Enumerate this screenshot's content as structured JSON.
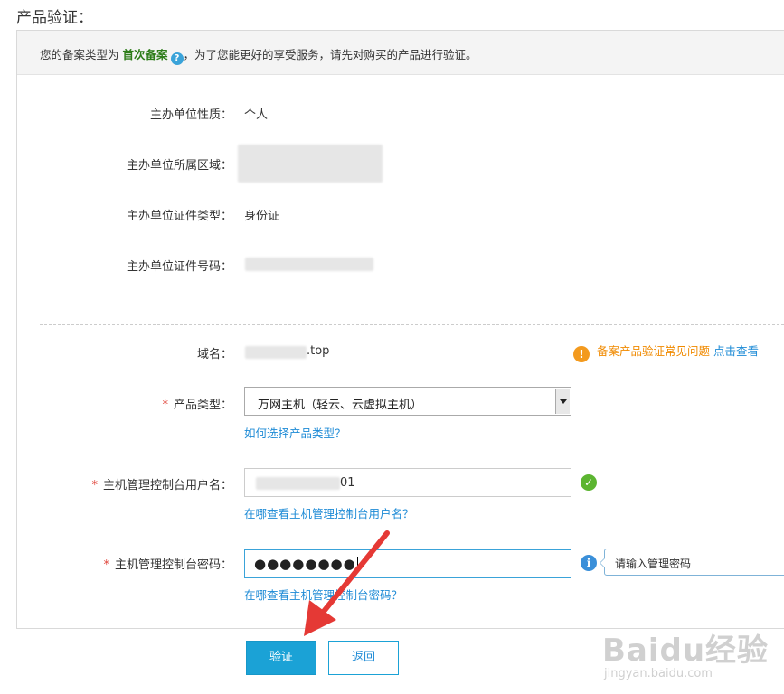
{
  "page": {
    "title": "产品验证："
  },
  "notice": {
    "prefix": "您的备案类型为",
    "type": "首次备案",
    "suffix": "，为了您能更好的享受服务，请先对购买的产品进行验证。"
  },
  "info": {
    "nature_label": "主办单位性质：",
    "nature_value": "个人",
    "region_label": "主办单位所属区域：",
    "cert_type_label": "主办单位证件类型：",
    "cert_type_value": "身份证",
    "cert_no_label": "主办单位证件号码："
  },
  "domain": {
    "label": "域名：",
    "value_suffix": ".top"
  },
  "help": {
    "faq": "备案产品验证常见问题",
    "link": "点击查看"
  },
  "form": {
    "product_type": {
      "label": "产品类型：",
      "value": "万网主机（轻云、云虚拟主机）",
      "help": "如何选择产品类型？"
    },
    "username": {
      "label": "主机管理控制台用户名：",
      "value_suffix": "01",
      "help": "在哪查看主机管理控制台用户名？"
    },
    "password": {
      "label": "主机管理控制台密码：",
      "value": "●●●●●●●●",
      "help": "在哪查看主机管理控制台密码？",
      "tooltip": "请输入管理密码"
    }
  },
  "buttons": {
    "verify": "验证",
    "back": "返回"
  },
  "watermark": {
    "main": "Baidu经验",
    "sub": "jingyan.baidu.com"
  },
  "colors": {
    "accent": "#1ba2d6",
    "required": "#e0443a",
    "highlight": "#2e7d1a",
    "warning": "#f39a1e",
    "success": "#5cb531"
  }
}
